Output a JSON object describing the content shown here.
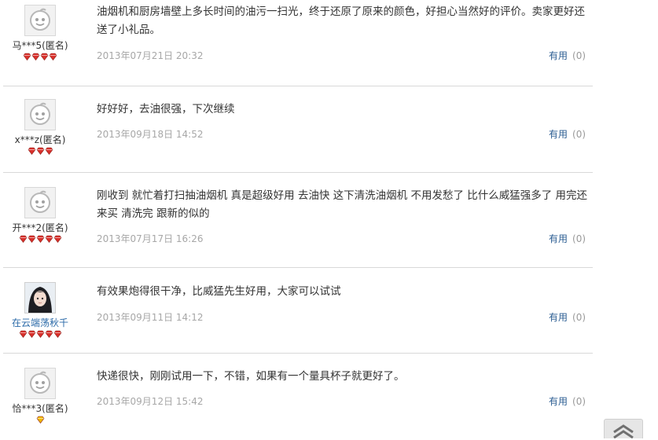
{
  "reviews": [
    {
      "username": "马***5(匿名)",
      "content": "油烟机和厨房墙壁上多长时间的油污一扫光，终于还原了原来的颜色，好担心当然好的评价。卖家更好还送了小礼品。",
      "date": "2013年07月21日 20:32",
      "useful_label": "有用",
      "useful_count": "(0)",
      "gem_count": 4,
      "gem_color": "#d9302b"
    },
    {
      "username": "x***z(匿名)",
      "content": "好好好，去油很强，下次继续",
      "date": "2013年09月18日 14:52",
      "useful_label": "有用",
      "useful_count": "(0)",
      "gem_count": 3,
      "gem_color": "#d9302b"
    },
    {
      "username": "开***2(匿名)",
      "content": "刚收到 就忙着打扫抽油烟机 真是超级好用 去油快 这下清洗油烟机 不用发愁了 比什么威猛强多了 用完还来买 清洗完 跟新的似的",
      "date": "2013年07月17日 16:26",
      "useful_label": "有用",
      "useful_count": "(0)",
      "gem_count": 5,
      "gem_color": "#d9302b"
    },
    {
      "username": "在云端荡秋千",
      "content": "有效果炮得很干净，比威猛先生好用，大家可以试试",
      "date": "2013年09月11日 14:12",
      "useful_label": "有用",
      "useful_count": "(0)",
      "gem_count": 5,
      "gem_color": "#d9302b"
    },
    {
      "username": "恰***3(匿名)",
      "content": "快递很快，刚刚试用一下，不错，如果有一个量具杯子就更好了。",
      "date": "2013年09月12日 15:42",
      "useful_label": "有用",
      "useful_count": "(0)",
      "gem_count": 1,
      "gem_color": "#f0b800"
    }
  ],
  "icons": {
    "default_avatar": "default-avatar-icon",
    "photo_avatar": "user-photo-avatar",
    "rank_gem": "rank-gem-icon",
    "back_to_top": "back-to-top-icon"
  },
  "colors": {
    "username_link": "#2b6aa8",
    "useful_link": "#2b5d92",
    "date_text": "#a7a7a7"
  }
}
